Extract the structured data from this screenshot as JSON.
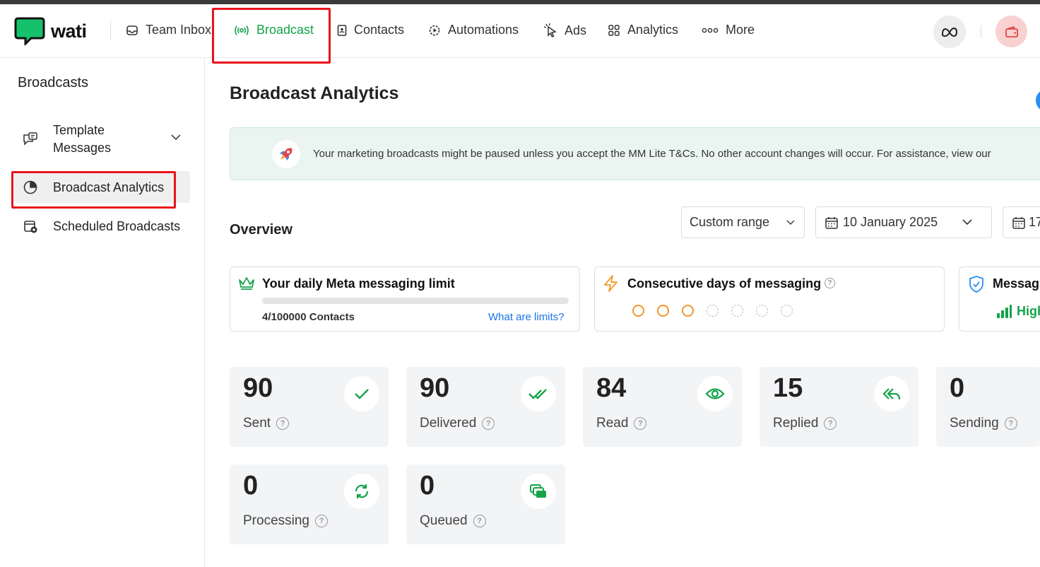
{
  "app": {
    "logo_text": "wati"
  },
  "topnav": {
    "items": [
      {
        "label": "Team Inbox",
        "icon": "inbox-icon"
      },
      {
        "label": "Broadcast",
        "icon": "broadcast-icon",
        "active": true
      },
      {
        "label": "Contacts",
        "icon": "contacts-icon"
      },
      {
        "label": "Automations",
        "icon": "automations-icon"
      },
      {
        "label": "Ads",
        "icon": "ads-icon"
      },
      {
        "label": "Analytics",
        "icon": "analytics-icon"
      },
      {
        "label": "More",
        "icon": "more-icon"
      }
    ],
    "meta_icon": "meta-icon",
    "wallet_icon": "wallet-icon"
  },
  "sidebar": {
    "title": "Broadcasts",
    "items": [
      {
        "label_line1": "Template",
        "label_line2": "Messages",
        "icon": "template-messages-icon",
        "expandable": true
      },
      {
        "label": "Broadcast Analytics",
        "icon": "pie-chart-icon",
        "active": true
      },
      {
        "label": "Scheduled Broadcasts",
        "icon": "scheduled-icon"
      }
    ]
  },
  "main": {
    "title": "Broadcast Analytics",
    "banner": {
      "icon": "rocket-icon",
      "text": "Your marketing broadcasts might be paused unless you accept the MM Lite T&Cs. No other account changes will occur. For assistance, view our"
    },
    "overview": {
      "title": "Overview",
      "range_select": "Custom range",
      "start_date": "10 January 2025",
      "end_date_partial": "17"
    },
    "cards": {
      "limit": {
        "title": "Your daily Meta messaging limit",
        "usage": "4/100000 Contacts",
        "used": 4,
        "total": 100000,
        "link": "What are limits?"
      },
      "consecutive": {
        "title": "Consecutive days of messaging",
        "days_active": 3,
        "days_total": 7
      },
      "quality": {
        "title_partial": "Messagi",
        "value_partial": "High"
      }
    },
    "stats": [
      {
        "value": "90",
        "label": "Sent",
        "icon": "check-icon"
      },
      {
        "value": "90",
        "label": "Delivered",
        "icon": "double-check-icon"
      },
      {
        "value": "84",
        "label": "Read",
        "icon": "eye-icon"
      },
      {
        "value": "15",
        "label": "Replied",
        "icon": "reply-all-icon"
      },
      {
        "value": "0",
        "label": "Sending",
        "icon": "sending-icon"
      },
      {
        "value": "0",
        "label": "Processing",
        "icon": "refresh-icon"
      },
      {
        "value": "0",
        "label": "Queued",
        "icon": "queue-icon"
      }
    ]
  },
  "colors": {
    "accent_green": "#15a34a",
    "highlight_red": "#e8141b",
    "link_blue": "#1a73e8",
    "orange": "#f0982e"
  }
}
